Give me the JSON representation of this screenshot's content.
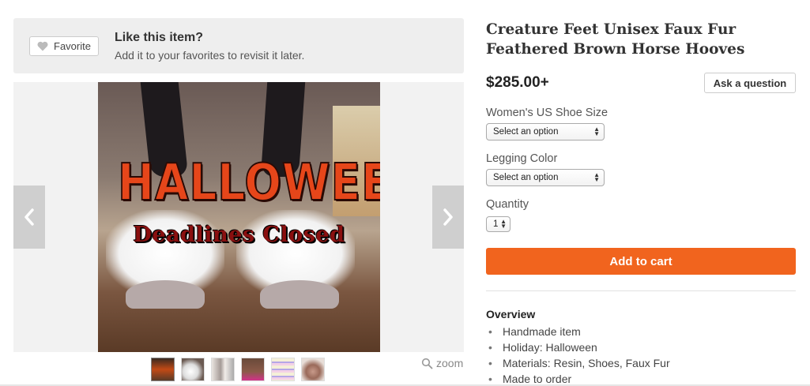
{
  "favorite": {
    "button_label": "Favorite",
    "title": "Like this item?",
    "subtitle": "Add it to your favorites to revisit it later.",
    "icon": "heart-icon"
  },
  "viewer": {
    "image_text_line1": "HALLOWEEN",
    "image_text_line2": "Deadlines Closed",
    "prev_icon": "chevron-left-icon",
    "next_icon": "chevron-right-icon",
    "thumbnail_count": 6,
    "zoom_label": "zoom"
  },
  "product": {
    "title": "Creature Feet Unisex Faux Fur Feathered Brown Horse Hooves",
    "price": "$285.00+",
    "ask_label": "Ask a question"
  },
  "options": {
    "shoe_size": {
      "label": "Women's US Shoe Size",
      "value": "Select an option"
    },
    "legging_color": {
      "label": "Legging Color",
      "value": "Select an option"
    },
    "quantity": {
      "label": "Quantity",
      "value": "1"
    }
  },
  "cart": {
    "label": "Add to cart",
    "color": "#f1641e"
  },
  "overview": {
    "heading": "Overview",
    "items": [
      "Handmade item",
      "Holiday: Halloween",
      "Materials: Resin, Shoes, Faux Fur",
      "Made to order"
    ]
  }
}
